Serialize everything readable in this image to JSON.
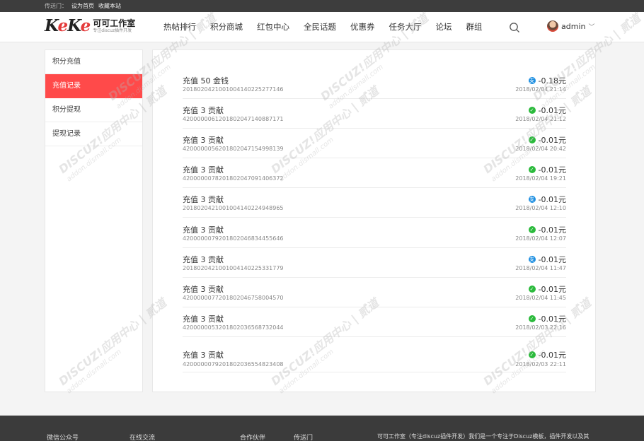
{
  "topbar": {
    "prefix": "传送门：",
    "set_home": "设为首页",
    "bookmark": "收藏本站"
  },
  "header": {
    "logo_mark": "KeKe",
    "logo_title": "可可工作室",
    "logo_sub": "专注discuz插件开发",
    "nav": [
      "热帖排行",
      "积分商城",
      "红包中心",
      "全民话题",
      "优惠券",
      "任务大厅",
      "论坛",
      "群组"
    ],
    "user": "admin"
  },
  "sidebar": {
    "items": [
      "积分充值",
      "充值记录",
      "积分提现",
      "提现记录"
    ],
    "active_index": 1
  },
  "records": [
    {
      "title": "充值 50 金钱",
      "id": "2018020421001004140225277146",
      "amount": "-0.18元",
      "date": "2018/02/04 21:14",
      "pay": "alipay"
    },
    {
      "title": "充值 3 贡献",
      "id": "4200000061201802047140887171",
      "amount": "-0.01元",
      "date": "2018/02/04 21:12",
      "pay": "wechat"
    },
    {
      "title": "充值 3 贡献",
      "id": "4200000056201802047154998139",
      "amount": "-0.01元",
      "date": "2018/02/04 20:42",
      "pay": "wechat"
    },
    {
      "title": "充值 3 贡献",
      "id": "4200000078201802047091406372",
      "amount": "-0.01元",
      "date": "2018/02/04 19:21",
      "pay": "wechat"
    },
    {
      "title": "充值 3 贡献",
      "id": "2018020421001004140224948965",
      "amount": "-0.01元",
      "date": "2018/02/04 12:10",
      "pay": "alipay"
    },
    {
      "title": "充值 3 贡献",
      "id": "4200000079201802046834455646",
      "amount": "-0.01元",
      "date": "2018/02/04 12:07",
      "pay": "wechat"
    },
    {
      "title": "充值 3 贡献",
      "id": "2018020421001004140225331779",
      "amount": "-0.01元",
      "date": "2018/02/04 11:47",
      "pay": "alipay"
    },
    {
      "title": "充值 3 贡献",
      "id": "4200000077201802046758004570",
      "amount": "-0.01元",
      "date": "2018/02/04 11:45",
      "pay": "wechat"
    },
    {
      "title": "充值 3 贡献",
      "id": "4200000053201802036568732044",
      "amount": "-0.01元",
      "date": "2018/02/03 22:16",
      "pay": "wechat"
    },
    {
      "title": "充值 3 贡献",
      "id": "4200000079201802036554823408",
      "amount": "-0.01元",
      "date": "2018/02/03 22:11",
      "pay": "wechat"
    }
  ],
  "watermark": {
    "main": "DISCUZ!应用中心 | 贰道",
    "sub": "addon.dismall.com"
  },
  "footer": {
    "wechat": "微信公众号",
    "online": "在线交流",
    "partners": "合作伙伴",
    "portal": "传送门",
    "about": "可可工作室（专注discuz插件开发）我们是一个专注于Discuz模板，插件开发以及其"
  },
  "colors": {
    "accent": "#ff4a4a",
    "alipay": "#1e8fe1",
    "wechat": "#2bba3c"
  }
}
